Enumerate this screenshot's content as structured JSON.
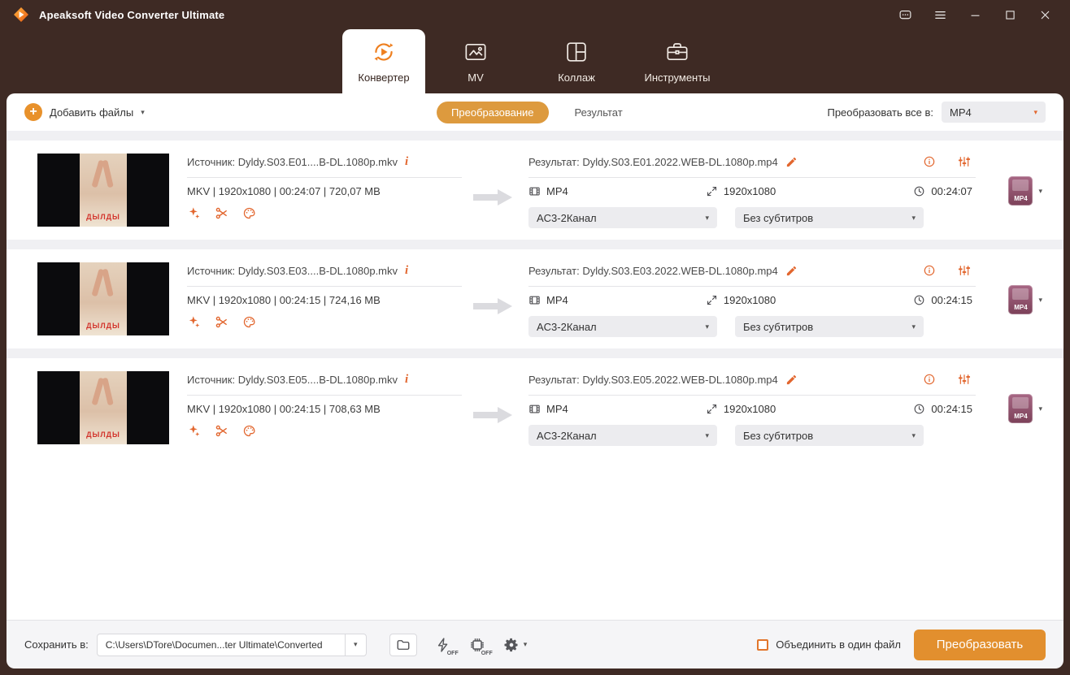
{
  "window": {
    "title": "Apeaksoft Video Converter Ultimate"
  },
  "tabs": {
    "converter": "Конвертер",
    "mv": "MV",
    "collage": "Коллаж",
    "tools": "Инструменты"
  },
  "toolbar": {
    "add_files": "Добавить файлы",
    "view_convert": "Преобразование",
    "view_result": "Результат",
    "convert_all_label": "Преобразовать все в:",
    "convert_all_value": "MP4"
  },
  "poster": {
    "title": "ДЫЛДЫ"
  },
  "rows": [
    {
      "source": "Источник: Dyldy.S03.E01....B-DL.1080p.mkv",
      "meta": "MKV | 1920x1080 | 00:24:07 | 720,07 MB",
      "result": "Результат: Dyldy.S03.E01.2022.WEB-DL.1080p.mp4",
      "format": "MP4",
      "resolution": "1920x1080",
      "duration": "00:24:07",
      "audio": "AC3-2Канал",
      "subtitles": "Без субтитров",
      "badge": "MP4"
    },
    {
      "source": "Источник: Dyldy.S03.E03....B-DL.1080p.mkv",
      "meta": "MKV | 1920x1080 | 00:24:15 | 724,16 MB",
      "result": "Результат: Dyldy.S03.E03.2022.WEB-DL.1080p.mp4",
      "format": "MP4",
      "resolution": "1920x1080",
      "duration": "00:24:15",
      "audio": "AC3-2Канал",
      "subtitles": "Без субтитров",
      "badge": "MP4"
    },
    {
      "source": "Источник: Dyldy.S03.E05....B-DL.1080p.mkv",
      "meta": "MKV | 1920x1080 | 00:24:15 | 708,63 MB",
      "result": "Результат: Dyldy.S03.E05.2022.WEB-DL.1080p.mp4",
      "format": "MP4",
      "resolution": "1920x1080",
      "duration": "00:24:15",
      "audio": "AC3-2Канал",
      "subtitles": "Без субтитров",
      "badge": "MP4"
    }
  ],
  "footer": {
    "save_label": "Сохранить в:",
    "path": "C:\\Users\\DTore\\Documen...ter Ultimate\\Converted",
    "off_label": "OFF",
    "merge_label": "Объединить в один файл",
    "convert_button": "Преобразовать"
  }
}
